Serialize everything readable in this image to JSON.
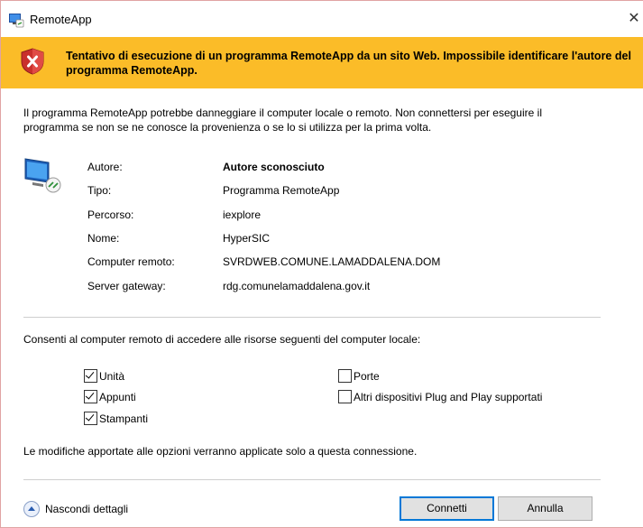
{
  "window": {
    "title": "RemoteApp",
    "close_glyph": "✕"
  },
  "banner": {
    "message": "Tentativo di esecuzione di un programma RemoteApp da un sito Web. Impossibile identificare l'autore del programma RemoteApp.",
    "icon": "error-shield-icon",
    "color": "#fbbc28"
  },
  "description": "Il programma RemoteApp potrebbe danneggiare il computer locale o remoto. Non connettersi per eseguire il programma se non se ne conosce la provenienza o se lo si utilizza per la prima volta.",
  "details": [
    {
      "label": "Autore:",
      "value": "Autore sconosciuto"
    },
    {
      "label": "Tipo:",
      "value": "Programma RemoteApp"
    },
    {
      "label": "Percorso:",
      "value": "iexplore"
    },
    {
      "label": "Nome:",
      "value": "HyperSIC"
    },
    {
      "label": "Computer remoto:",
      "value": "SVRDWEB.COMUNE.LAMADDALENA.DOM"
    },
    {
      "label": "Server gateway:",
      "value": "rdg.comunelamaddalena.gov.it"
    }
  ],
  "permissions": {
    "heading": "Consenti al computer remoto di accedere alle risorse seguenti del computer locale:",
    "items": [
      {
        "label": "Unità",
        "checked": true
      },
      {
        "label": "Appunti",
        "checked": true
      },
      {
        "label": "Stampanti",
        "checked": true
      },
      {
        "label": "Porte",
        "checked": false
      },
      {
        "label": "Altri dispositivi Plug and Play supportati",
        "checked": false
      }
    ]
  },
  "note": "Le modifiche apportate alle opzioni verranno applicate solo a questa connessione.",
  "footer": {
    "toggle_label": "Nascondi dettagli",
    "connect_label": "Connetti",
    "cancel_label": "Annulla"
  }
}
